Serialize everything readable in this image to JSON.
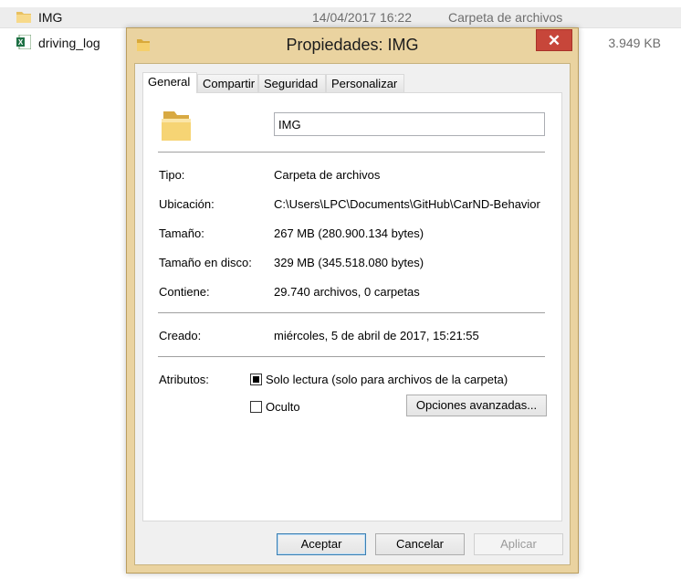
{
  "background": {
    "rows": [
      {
        "name": "IMG",
        "date": "14/04/2017 16:22",
        "type": "Carpeta de archivos",
        "size": ""
      },
      {
        "name": "driving_log",
        "date": "",
        "type": "",
        "size": "3.949 KB"
      }
    ]
  },
  "dialog": {
    "title": "Propiedades: IMG",
    "close_label": "✕",
    "tabs": [
      "General",
      "Compartir",
      "Seguridad",
      "Personalizar"
    ],
    "active_tab": "General",
    "name_value": "IMG",
    "props": [
      {
        "label": "Tipo:",
        "value": "Carpeta de archivos"
      },
      {
        "label": "Ubicación:",
        "value": "C:\\Users\\LPC\\Documents\\GitHub\\CarND-Behavior"
      },
      {
        "label": "Tamaño:",
        "value": "267 MB (280.900.134 bytes)"
      },
      {
        "label": "Tamaño en disco:",
        "value": "329 MB (345.518.080 bytes)"
      },
      {
        "label": "Contiene:",
        "value": "29.740 archivos, 0 carpetas"
      }
    ],
    "created": {
      "label": "Creado:",
      "value": "miércoles, 5 de abril de 2017, 15:21:55"
    },
    "attributes": {
      "label": "Atributos:",
      "readonly_label": "Solo lectura (solo para archivos de la carpeta)",
      "readonly_state": "indeterminate",
      "hidden_label": "Oculto",
      "hidden_checked": false,
      "advanced_button": "Opciones avanzadas..."
    },
    "buttons": {
      "ok": "Aceptar",
      "cancel": "Cancelar",
      "apply": "Aplicar"
    }
  },
  "colors": {
    "frame": "#ead3a0",
    "close": "#c7463a",
    "folder": "#f3d37a"
  },
  "icons": {
    "folder": "folder-icon",
    "excel": "excel-file-icon",
    "close": "close-icon"
  }
}
